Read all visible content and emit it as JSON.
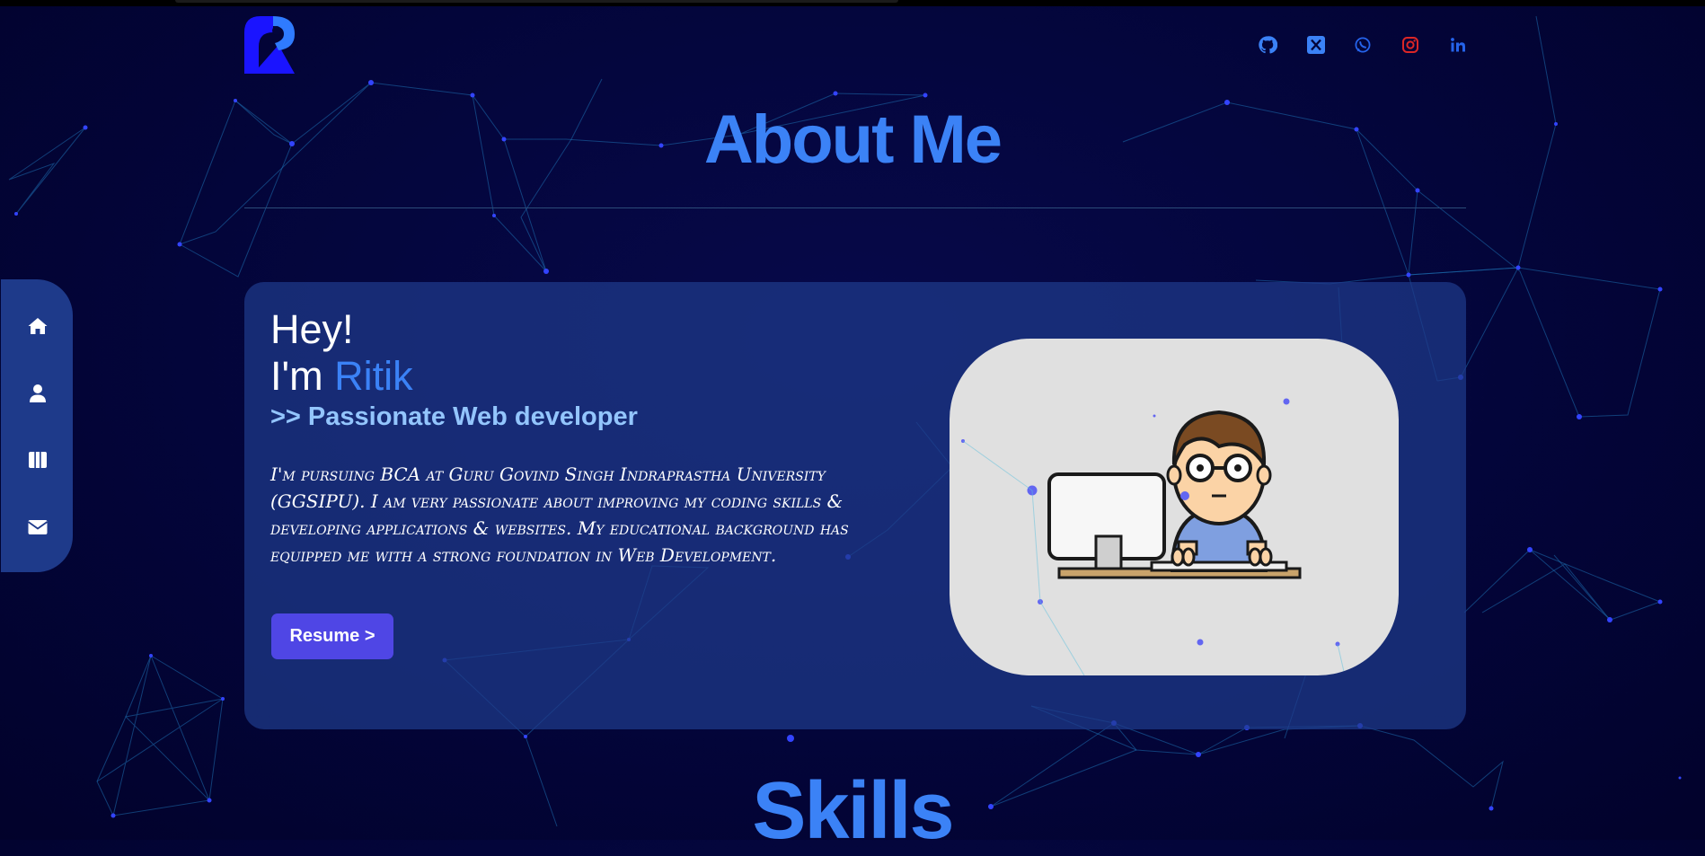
{
  "header": {
    "logo_icon": "brand-logo-r",
    "social_links": [
      {
        "name": "github",
        "icon": "github-icon",
        "color": "#3b82f6"
      },
      {
        "name": "x",
        "icon": "x-icon",
        "color": "#3b82f6"
      },
      {
        "name": "whatsapp",
        "icon": "whatsapp-icon",
        "color": "#2563eb"
      },
      {
        "name": "instagram",
        "icon": "instagram-icon",
        "color": "#dc2626"
      },
      {
        "name": "linkedin",
        "icon": "linkedin-icon",
        "color": "#2563eb"
      }
    ]
  },
  "sidenav": {
    "items": [
      {
        "name": "home",
        "icon": "home-icon"
      },
      {
        "name": "about",
        "icon": "user-icon"
      },
      {
        "name": "projects",
        "icon": "columns-icon"
      },
      {
        "name": "contact",
        "icon": "mail-icon"
      }
    ]
  },
  "about": {
    "title": "About Me",
    "greeting": "Hey!",
    "intro_prefix": "I'm ",
    "name": "Ritik",
    "tagline": ">> Passionate Web developer",
    "bio": "I'm pursuing BCA at Guru Govind Singh Indraprastha University (GGSIPU). I am very passionate about improving my coding skills & developing applications & websites. My educational background has equipped me with a strong foundation in Web Development.",
    "resume_button": "Resume >",
    "illustration": "developer-at-computer-illustration"
  },
  "next_section": {
    "title": "Skills"
  },
  "colors": {
    "background": "#03053a",
    "accent": "#3b82f6",
    "card": "#1e3a8a",
    "button": "#4f46e5",
    "tagline": "#93c5fd"
  }
}
